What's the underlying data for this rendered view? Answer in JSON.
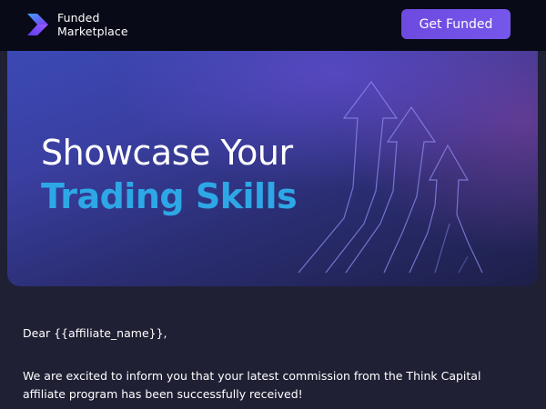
{
  "header": {
    "brand_line1": "Funded",
    "brand_line2": "Marketplace",
    "cta_label": "Get Funded"
  },
  "hero": {
    "title_line1": "Showcase Your",
    "title_line2": "Trading Skills"
  },
  "email": {
    "greeting": "Dear {{affiliate_name}},",
    "message": "We are excited to inform you that your latest commission from the Think Capital affiliate program has been successfully received!"
  },
  "colors": {
    "header_bg": "#080a17",
    "accent_purple": "#6d4ae0",
    "title_blue": "#2ea7e6",
    "body_bg": "#1f2034"
  },
  "icons": [
    "logo-chevron-icon",
    "growth-arrows-graphic"
  ]
}
